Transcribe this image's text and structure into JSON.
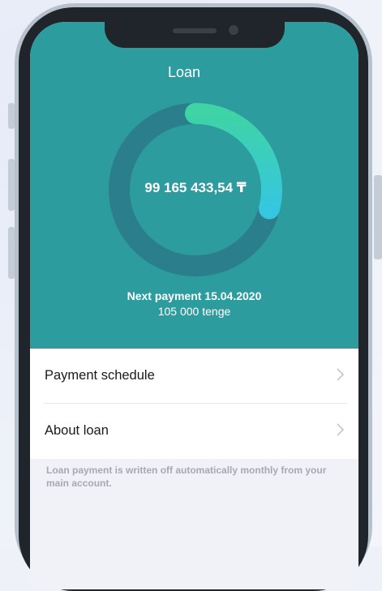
{
  "header": {
    "title": "Loan",
    "amount": "99 165 433,54 ₸",
    "next_payment_line": "Next payment 15.04.2020",
    "next_payment_amount": "105 000 tenge",
    "progress_fraction": 0.29
  },
  "menu": {
    "items": [
      {
        "label": "Payment schedule"
      },
      {
        "label": "About loan"
      }
    ]
  },
  "note": "Loan payment is written off automatically monthly from your main account.",
  "colors": {
    "header_bg": "#2d9c9e",
    "ring_track": "#2b7f8c",
    "ring_progress_start": "#3fd3a6",
    "ring_progress_end": "#35c7df"
  },
  "icons": [
    "chevron-right-icon",
    "speaker-icon",
    "camera-icon"
  ]
}
